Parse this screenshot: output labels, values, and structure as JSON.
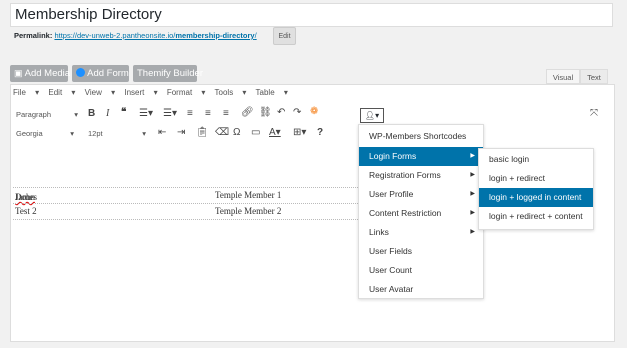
{
  "title": "Membership Directory",
  "permalink": {
    "label": "Permalink:",
    "url_base": "https://dev-unweb-2.pantheonsite.io/",
    "url_slug": "membership-directory",
    "url_tail": "/",
    "edit_label": "Edit"
  },
  "media_buttons": {
    "add_media": "Add Media",
    "add_form": "Add Form",
    "themify": "Themify Builder"
  },
  "tabs": {
    "visual": "Visual",
    "text": "Text"
  },
  "menubar": [
    "File",
    "Edit",
    "View",
    "Insert",
    "Format",
    "Tools",
    "Table"
  ],
  "toolbar": {
    "paragraph": "Paragraph",
    "font_family": "Georgia",
    "font_size": "12pt"
  },
  "table_rows": [
    {
      "name_first": "James ",
      "name_last": "Dohn",
      "role": "Temple Member 1"
    },
    {
      "name_first": "Test 2",
      "name_last": "",
      "role": "Temple Member 2"
    }
  ],
  "main_menu": {
    "items": [
      {
        "label": "WP-Members Shortcodes",
        "submenu": false
      },
      {
        "label": "Login Forms",
        "submenu": true
      },
      {
        "label": "Registration Forms",
        "submenu": true
      },
      {
        "label": "User Profile",
        "submenu": true
      },
      {
        "label": "Content Restriction",
        "submenu": true
      },
      {
        "label": "Links",
        "submenu": true
      },
      {
        "label": "User Fields",
        "submenu": false
      },
      {
        "label": "User Count",
        "submenu": false
      },
      {
        "label": "User Avatar",
        "submenu": false
      }
    ],
    "active_index": 1
  },
  "sub_menu": {
    "items": [
      {
        "label": "basic login"
      },
      {
        "label": "login + redirect"
      },
      {
        "label": "login + logged in content"
      },
      {
        "label": "login + redirect + content"
      }
    ],
    "active_index": 2
  },
  "colors": {
    "accent": "#0073aa",
    "button_gray": "#a7aaad"
  }
}
